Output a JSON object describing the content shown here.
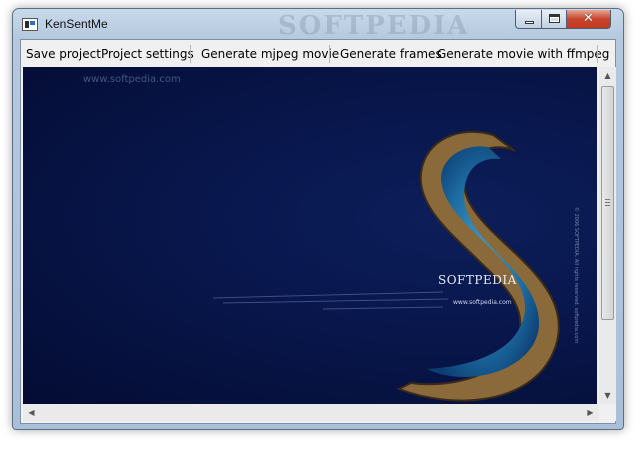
{
  "window": {
    "title": "KenSentMe",
    "title_watermark": "SOFTPEDIA",
    "controls": {
      "close_glyph": "✕"
    }
  },
  "menubar": {
    "items": [
      {
        "label": "Save project"
      },
      {
        "label": "Project settings"
      },
      {
        "label": "Generate mjpeg movie"
      },
      {
        "label": "Generate frames"
      },
      {
        "label": "Generate movie with ffmpeg"
      }
    ]
  },
  "canvas": {
    "watermark_url": "www.softpedia.com",
    "brand": "SOFTPEDIA",
    "brand_url": "www.softpedia.com",
    "side_text": "© 2006 SOFTPEDIA. All rights reserved. softpedia.com"
  },
  "scrollbars": {
    "vertical": {
      "up_glyph": "▲",
      "down_glyph": "▼"
    },
    "horizontal": {
      "left_glyph": "◀",
      "right_glyph": "▶"
    }
  },
  "colors": {
    "canvas_bg": "#08164b",
    "island_rock": "#8a6a3a",
    "lagoon": "#1d6ea3",
    "close_button": "#c8442d"
  }
}
